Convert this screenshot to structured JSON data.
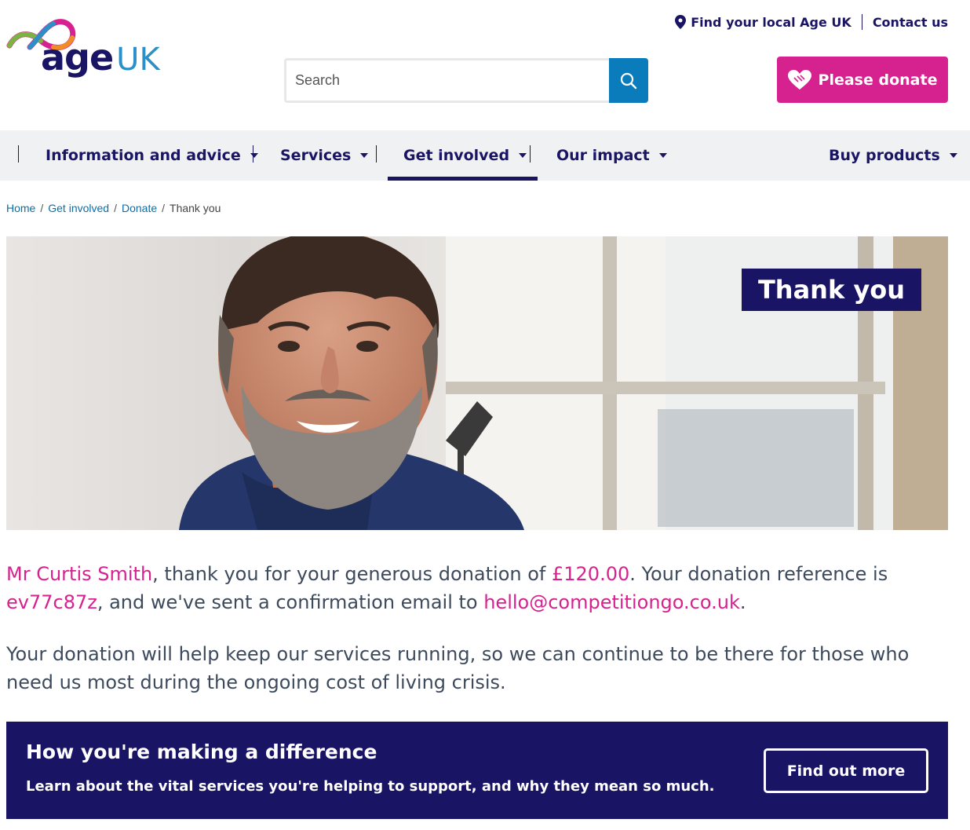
{
  "brand": {
    "logo_main": "age",
    "logo_accent": "UK",
    "primary_color": "#1a1464",
    "accent_color": "#d6228e",
    "link_color": "#0a6ea8"
  },
  "header": {
    "find_local": "Find your local Age UK",
    "contact": "Contact us",
    "search_placeholder": "Search",
    "donate_label": "Please donate"
  },
  "nav": {
    "items": [
      {
        "label": "Information and advice",
        "active": false
      },
      {
        "label": "Services",
        "active": false
      },
      {
        "label": "Get involved",
        "active": true
      },
      {
        "label": "Our impact",
        "active": false
      },
      {
        "label": "Buy products",
        "active": false
      }
    ]
  },
  "breadcrumb": {
    "items": [
      "Home",
      "Get involved",
      "Donate"
    ],
    "current": "Thank you"
  },
  "hero": {
    "badge": "Thank you",
    "image": "smiling-bearded-man-photo"
  },
  "confirmation": {
    "name": "Mr Curtis Smith",
    "text1": ", thank you for your generous donation of ",
    "amount": "£120.00",
    "text2": ". Your donation reference is ",
    "reference": "ev77c87z",
    "text3": ", and we've sent a confirmation email to ",
    "email": "hello@competitiongo.co.uk",
    "text4": "."
  },
  "impact_text": "Your donation will help keep our services running, so we can continue to be there for those who need us most during the ongoing cost of living crisis.",
  "banner": {
    "title": "How you're making a difference",
    "subtitle": "Learn about the vital services you're helping to support, and why they mean so much.",
    "button": "Find out more"
  }
}
